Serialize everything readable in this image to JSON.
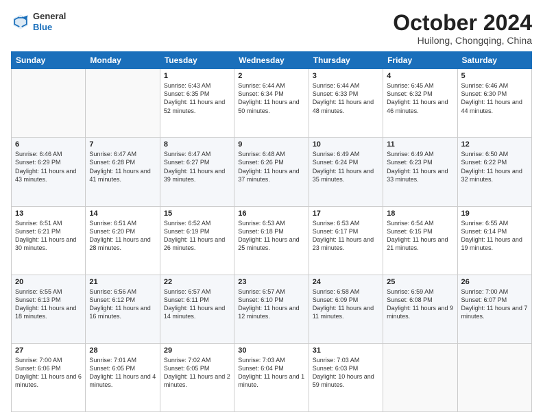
{
  "logo": {
    "general": "General",
    "blue": "Blue"
  },
  "header": {
    "month": "October 2024",
    "location": "Huilong, Chongqing, China"
  },
  "weekdays": [
    "Sunday",
    "Monday",
    "Tuesday",
    "Wednesday",
    "Thursday",
    "Friday",
    "Saturday"
  ],
  "weeks": [
    [
      {
        "day": "",
        "sunrise": "",
        "sunset": "",
        "daylight": ""
      },
      {
        "day": "",
        "sunrise": "",
        "sunset": "",
        "daylight": ""
      },
      {
        "day": "1",
        "sunrise": "Sunrise: 6:43 AM",
        "sunset": "Sunset: 6:35 PM",
        "daylight": "Daylight: 11 hours and 52 minutes."
      },
      {
        "day": "2",
        "sunrise": "Sunrise: 6:44 AM",
        "sunset": "Sunset: 6:34 PM",
        "daylight": "Daylight: 11 hours and 50 minutes."
      },
      {
        "day": "3",
        "sunrise": "Sunrise: 6:44 AM",
        "sunset": "Sunset: 6:33 PM",
        "daylight": "Daylight: 11 hours and 48 minutes."
      },
      {
        "day": "4",
        "sunrise": "Sunrise: 6:45 AM",
        "sunset": "Sunset: 6:32 PM",
        "daylight": "Daylight: 11 hours and 46 minutes."
      },
      {
        "day": "5",
        "sunrise": "Sunrise: 6:46 AM",
        "sunset": "Sunset: 6:30 PM",
        "daylight": "Daylight: 11 hours and 44 minutes."
      }
    ],
    [
      {
        "day": "6",
        "sunrise": "Sunrise: 6:46 AM",
        "sunset": "Sunset: 6:29 PM",
        "daylight": "Daylight: 11 hours and 43 minutes."
      },
      {
        "day": "7",
        "sunrise": "Sunrise: 6:47 AM",
        "sunset": "Sunset: 6:28 PM",
        "daylight": "Daylight: 11 hours and 41 minutes."
      },
      {
        "day": "8",
        "sunrise": "Sunrise: 6:47 AM",
        "sunset": "Sunset: 6:27 PM",
        "daylight": "Daylight: 11 hours and 39 minutes."
      },
      {
        "day": "9",
        "sunrise": "Sunrise: 6:48 AM",
        "sunset": "Sunset: 6:26 PM",
        "daylight": "Daylight: 11 hours and 37 minutes."
      },
      {
        "day": "10",
        "sunrise": "Sunrise: 6:49 AM",
        "sunset": "Sunset: 6:24 PM",
        "daylight": "Daylight: 11 hours and 35 minutes."
      },
      {
        "day": "11",
        "sunrise": "Sunrise: 6:49 AM",
        "sunset": "Sunset: 6:23 PM",
        "daylight": "Daylight: 11 hours and 33 minutes."
      },
      {
        "day": "12",
        "sunrise": "Sunrise: 6:50 AM",
        "sunset": "Sunset: 6:22 PM",
        "daylight": "Daylight: 11 hours and 32 minutes."
      }
    ],
    [
      {
        "day": "13",
        "sunrise": "Sunrise: 6:51 AM",
        "sunset": "Sunset: 6:21 PM",
        "daylight": "Daylight: 11 hours and 30 minutes."
      },
      {
        "day": "14",
        "sunrise": "Sunrise: 6:51 AM",
        "sunset": "Sunset: 6:20 PM",
        "daylight": "Daylight: 11 hours and 28 minutes."
      },
      {
        "day": "15",
        "sunrise": "Sunrise: 6:52 AM",
        "sunset": "Sunset: 6:19 PM",
        "daylight": "Daylight: 11 hours and 26 minutes."
      },
      {
        "day": "16",
        "sunrise": "Sunrise: 6:53 AM",
        "sunset": "Sunset: 6:18 PM",
        "daylight": "Daylight: 11 hours and 25 minutes."
      },
      {
        "day": "17",
        "sunrise": "Sunrise: 6:53 AM",
        "sunset": "Sunset: 6:17 PM",
        "daylight": "Daylight: 11 hours and 23 minutes."
      },
      {
        "day": "18",
        "sunrise": "Sunrise: 6:54 AM",
        "sunset": "Sunset: 6:15 PM",
        "daylight": "Daylight: 11 hours and 21 minutes."
      },
      {
        "day": "19",
        "sunrise": "Sunrise: 6:55 AM",
        "sunset": "Sunset: 6:14 PM",
        "daylight": "Daylight: 11 hours and 19 minutes."
      }
    ],
    [
      {
        "day": "20",
        "sunrise": "Sunrise: 6:55 AM",
        "sunset": "Sunset: 6:13 PM",
        "daylight": "Daylight: 11 hours and 18 minutes."
      },
      {
        "day": "21",
        "sunrise": "Sunrise: 6:56 AM",
        "sunset": "Sunset: 6:12 PM",
        "daylight": "Daylight: 11 hours and 16 minutes."
      },
      {
        "day": "22",
        "sunrise": "Sunrise: 6:57 AM",
        "sunset": "Sunset: 6:11 PM",
        "daylight": "Daylight: 11 hours and 14 minutes."
      },
      {
        "day": "23",
        "sunrise": "Sunrise: 6:57 AM",
        "sunset": "Sunset: 6:10 PM",
        "daylight": "Daylight: 11 hours and 12 minutes."
      },
      {
        "day": "24",
        "sunrise": "Sunrise: 6:58 AM",
        "sunset": "Sunset: 6:09 PM",
        "daylight": "Daylight: 11 hours and 11 minutes."
      },
      {
        "day": "25",
        "sunrise": "Sunrise: 6:59 AM",
        "sunset": "Sunset: 6:08 PM",
        "daylight": "Daylight: 11 hours and 9 minutes."
      },
      {
        "day": "26",
        "sunrise": "Sunrise: 7:00 AM",
        "sunset": "Sunset: 6:07 PM",
        "daylight": "Daylight: 11 hours and 7 minutes."
      }
    ],
    [
      {
        "day": "27",
        "sunrise": "Sunrise: 7:00 AM",
        "sunset": "Sunset: 6:06 PM",
        "daylight": "Daylight: 11 hours and 6 minutes."
      },
      {
        "day": "28",
        "sunrise": "Sunrise: 7:01 AM",
        "sunset": "Sunset: 6:05 PM",
        "daylight": "Daylight: 11 hours and 4 minutes."
      },
      {
        "day": "29",
        "sunrise": "Sunrise: 7:02 AM",
        "sunset": "Sunset: 6:05 PM",
        "daylight": "Daylight: 11 hours and 2 minutes."
      },
      {
        "day": "30",
        "sunrise": "Sunrise: 7:03 AM",
        "sunset": "Sunset: 6:04 PM",
        "daylight": "Daylight: 11 hours and 1 minute."
      },
      {
        "day": "31",
        "sunrise": "Sunrise: 7:03 AM",
        "sunset": "Sunset: 6:03 PM",
        "daylight": "Daylight: 10 hours and 59 minutes."
      },
      {
        "day": "",
        "sunrise": "",
        "sunset": "",
        "daylight": ""
      },
      {
        "day": "",
        "sunrise": "",
        "sunset": "",
        "daylight": ""
      }
    ]
  ]
}
